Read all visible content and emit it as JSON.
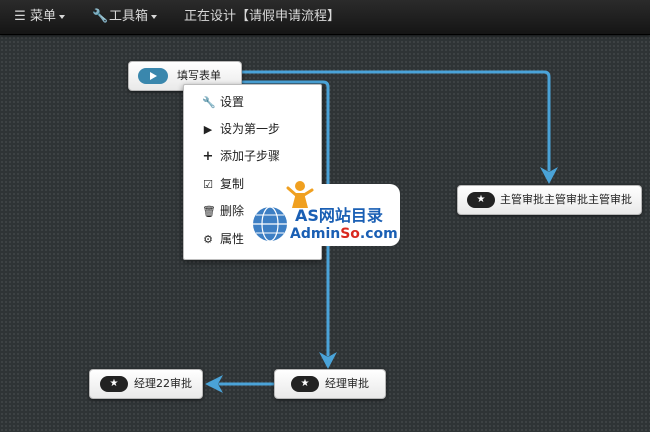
{
  "navbar": {
    "menu_label": "菜单",
    "toolbox_label": "工具箱",
    "title": "正在设计【请假申请流程】"
  },
  "nodes": {
    "start": {
      "label": "填写表单",
      "icon": "play-icon"
    },
    "supervisor": {
      "label": "主管审批主管审批主管审批",
      "icon": "star-icon"
    },
    "manager": {
      "label": "经理审批",
      "icon": "star-icon"
    },
    "manager22": {
      "label": "经理22审批",
      "icon": "star-icon"
    }
  },
  "context_menu": {
    "items": [
      {
        "label": "设置",
        "icon": "wrench-icon"
      },
      {
        "label": "设为第一步",
        "icon": "play-icon"
      },
      {
        "label": "添加子步骤",
        "icon": "plus-icon"
      },
      {
        "label": "复制",
        "icon": "checkbox-icon"
      },
      {
        "label": "删除",
        "icon": "trash-icon"
      },
      {
        "label": "属性",
        "icon": "gear-icon"
      }
    ]
  },
  "watermark": {
    "line1": "AS网站目录",
    "line2_part1": "Admin",
    "line2_part2": "So",
    "line2_part3": ".com"
  },
  "colors": {
    "connector": "#4aa3d8",
    "start_pill": "#3a87ad",
    "star_pill": "#222222",
    "navbar": "#1c1c1c"
  }
}
